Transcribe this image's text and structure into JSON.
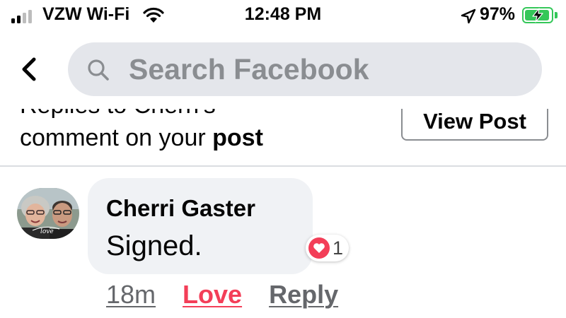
{
  "status_bar": {
    "carrier": "VZW Wi-Fi",
    "time": "12:48 PM",
    "battery_percent": "97%",
    "battery_level": 0.97,
    "signal_bars": 2,
    "icons": [
      "signal-icon",
      "wifi-icon",
      "location-icon",
      "battery-icon"
    ]
  },
  "header": {
    "back_icon": "chevron-left-icon",
    "search_placeholder": "Search Facebook"
  },
  "notification": {
    "text_line1": "Replies to Cherri's",
    "text_line2_prefix": "comment on your ",
    "text_line2_bold": "post",
    "view_post_label": "View Post"
  },
  "comment": {
    "author": "Cherri Gaster",
    "text": "Signed.",
    "avatar_caption": "love",
    "reaction": {
      "type": "love",
      "count": "1"
    },
    "actions": {
      "time": "18m",
      "love": "Love",
      "reply": "Reply"
    }
  },
  "colors": {
    "search_bg": "#e4e6eb",
    "bubble_bg": "#f0f2f5",
    "love_red": "#f33e58",
    "battery_green": "#34c759",
    "secondary_text": "#65676b"
  }
}
